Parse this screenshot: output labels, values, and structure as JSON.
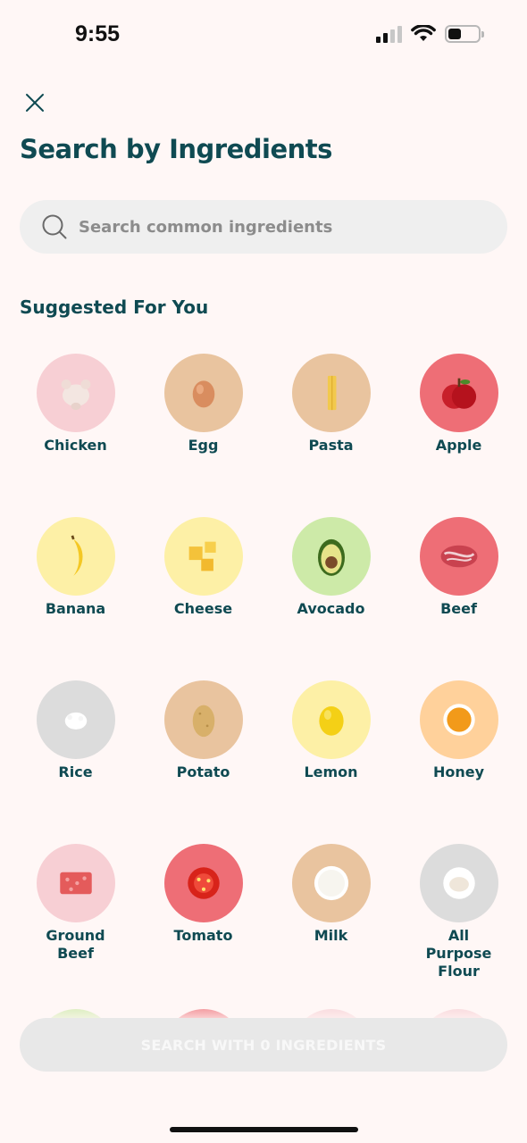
{
  "status_bar": {
    "time": "9:55"
  },
  "header": {
    "title": "Search by Ingredients"
  },
  "search": {
    "placeholder": "Search common ingredients",
    "value": ""
  },
  "section": {
    "title": "Suggested For You"
  },
  "ingredients": [
    {
      "label": "Chicken",
      "bg": "#f7cfd4",
      "icon": "chicken-icon"
    },
    {
      "label": "Egg",
      "bg": "#e9c49f",
      "icon": "egg-icon"
    },
    {
      "label": "Pasta",
      "bg": "#e9c49f",
      "icon": "pasta-icon"
    },
    {
      "label": "Apple",
      "bg": "#ee6e76",
      "icon": "apple-icon"
    },
    {
      "label": "Banana",
      "bg": "#fdf0a6",
      "icon": "banana-icon"
    },
    {
      "label": "Cheese",
      "bg": "#fdf0a6",
      "icon": "cheese-icon"
    },
    {
      "label": "Avocado",
      "bg": "#cdeaa8",
      "icon": "avocado-icon"
    },
    {
      "label": "Beef",
      "bg": "#ee6e76",
      "icon": "beef-icon"
    },
    {
      "label": "Rice",
      "bg": "#dcdcdc",
      "icon": "rice-icon"
    },
    {
      "label": "Potato",
      "bg": "#e9c49f",
      "icon": "potato-icon"
    },
    {
      "label": "Lemon",
      "bg": "#fdf0a6",
      "icon": "lemon-icon"
    },
    {
      "label": "Honey",
      "bg": "#ffd19b",
      "icon": "honey-icon"
    },
    {
      "label": "Ground Beef",
      "bg": "#f7cfd4",
      "icon": "ground-beef-icon"
    },
    {
      "label": "Tomato",
      "bg": "#ee6e76",
      "icon": "tomato-icon"
    },
    {
      "label": "Milk",
      "bg": "#e9c49f",
      "icon": "milk-icon"
    },
    {
      "label": "All Purpose Flour",
      "bg": "#dcdcdc",
      "icon": "flour-icon"
    }
  ],
  "bottom": {
    "button_label": "SEARCH WITH 0 INGREDIENTS"
  },
  "colors": {
    "accent": "#0f4a52",
    "background": "#fff7f6",
    "button_disabled": "#e8e8e8"
  }
}
